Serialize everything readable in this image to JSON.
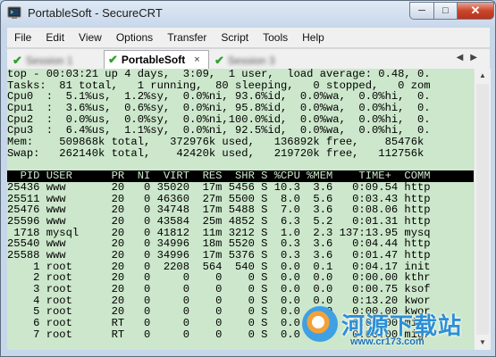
{
  "window": {
    "title": "PortableSoft - SecureCRT",
    "controls": {
      "minimize": "─",
      "maximize": "□",
      "close": "✕"
    }
  },
  "menu": [
    "File",
    "Edit",
    "View",
    "Options",
    "Transfer",
    "Script",
    "Tools",
    "Help"
  ],
  "tabs": [
    {
      "label": "Session 1",
      "blurred": true
    },
    {
      "label": "PortableSoft",
      "active": true,
      "close": "×"
    },
    {
      "label": "Session 3",
      "blurred": true
    }
  ],
  "tab_scroll": "◀▶",
  "terminal": {
    "summary": [
      "top - 00:03:21 up 4 days,  3:09,  1 user,  load average: 0.48, 0.",
      "Tasks:  81 total,   1 running,  80 sleeping,   0 stopped,   0 zom",
      "Cpu0  :  5.1%us,  1.2%sy,  0.0%ni, 93.6%id,  0.0%wa,  0.0%hi,  0.",
      "Cpu1  :  3.6%us,  0.6%sy,  0.0%ni, 95.8%id,  0.0%wa,  0.0%hi,  0.",
      "Cpu2  :  0.0%us,  0.0%sy,  0.0%ni,100.0%id,  0.0%wa,  0.0%hi,  0.",
      "Cpu3  :  6.4%us,  1.1%sy,  0.0%ni, 92.5%id,  0.0%wa,  0.0%hi,  0.",
      "Mem:    509868k total,   372976k used,   136892k free,    85476k",
      "Swap:   262140k total,    42420k used,   219720k free,   112756k",
      ""
    ],
    "header": "  PID USER      PR  NI  VIRT  RES  SHR S %CPU %MEM    TIME+  COMM",
    "processes": [
      "25436 www       20   0 35020  17m 5456 S 10.3  3.6   0:09.54 http",
      "25511 www       20   0 46360  27m 5500 S  8.0  5.6   0:03.43 http",
      "25476 www       20   0 34748  17m 5488 S  7.0  3.6   0:08.06 http",
      "25596 www       20   0 43584  25m 4852 S  6.3  5.2   0:01.31 http",
      " 1718 mysql     20   0 41812  11m 3212 S  1.0  2.3 137:13.95 mysq",
      "25540 www       20   0 34996  18m 5520 S  0.3  3.6   0:04.44 http",
      "25588 www       20   0 34996  17m 5376 S  0.3  3.6   0:01.47 http",
      "    1 root      20   0  2208  564  540 S  0.0  0.1   0:04.17 init",
      "    2 root      20   0     0    0    0 S  0.0  0.0   0:00.00 kthr",
      "    3 root      20   0     0    0    0 S  0.0  0.0   0:00.75 ksof",
      "    4 root      20   0     0    0    0 S  0.0  0.0   0:13.20 kwor",
      "    5 root      20   0     0    0    0 S  0.0  0.0   0:00.00 kwor",
      "    6 root      RT   0     0    0    0 S  0.0  0.0   0:00.00 migr",
      "    7 root      RT   0     0    0    0 S  0.0  0.0   0:00.00 migr"
    ]
  },
  "scrollbar": {
    "up": "▲",
    "down": "▼"
  },
  "watermark": {
    "site": "河源下载站",
    "url": "www.cr173.com"
  }
}
